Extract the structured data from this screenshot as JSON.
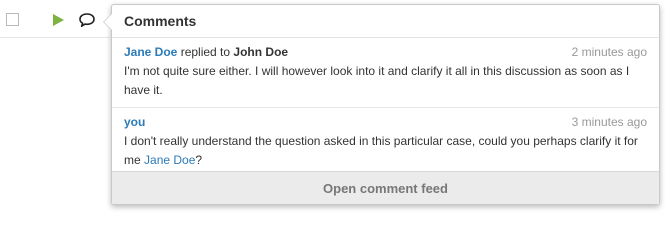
{
  "popover": {
    "title": "Comments",
    "comments": [
      {
        "author": "Jane Doe",
        "verb": "replied to",
        "recipient": "John Doe",
        "time": "2 minutes ago",
        "body": "I'm not quite sure either. I will however look into it and clarify it all in this discussion as soon as I have it."
      },
      {
        "author": "you",
        "time": "3 minutes ago",
        "body": "I don't really understand the question asked in this particular case, could you perhaps clarify it for me ",
        "mention": "Jane Doe",
        "body_end": "?"
      }
    ],
    "footer_label": "Open comment feed"
  },
  "icons": {
    "play": "play-icon",
    "comment": "speech-bubble-icon"
  },
  "colors": {
    "accent_link": "#2b7bb9",
    "play_green": "#7cb342",
    "footer_bg": "#ebebeb"
  }
}
